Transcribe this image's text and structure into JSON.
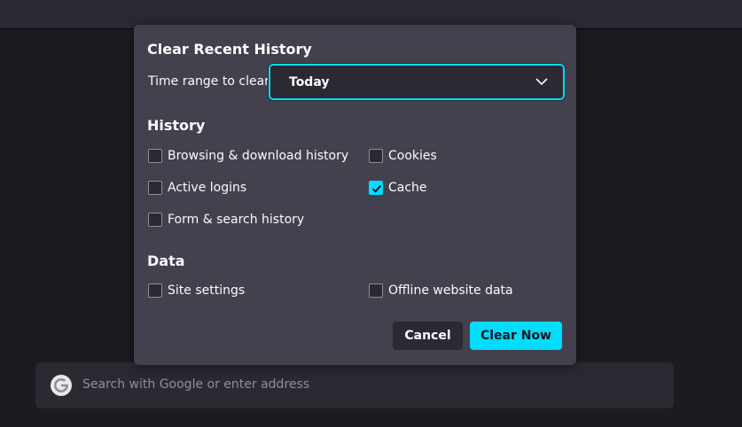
{
  "dialog": {
    "title": "Clear Recent History",
    "time_range_label": "Time range to clear:",
    "time_range_value": "Today"
  },
  "history": {
    "title": "History",
    "items": [
      {
        "label": "Browsing & download history",
        "checked": false
      },
      {
        "label": "Cookies",
        "checked": false
      },
      {
        "label": "Active logins",
        "checked": false
      },
      {
        "label": "Cache",
        "checked": true
      },
      {
        "label": "Form & search history",
        "checked": false
      }
    ]
  },
  "data": {
    "title": "Data",
    "items": [
      {
        "label": "Site settings",
        "checked": false
      },
      {
        "label": "Offline website data",
        "checked": false
      }
    ]
  },
  "buttons": {
    "cancel": "Cancel",
    "clear_now": "Clear Now"
  },
  "search": {
    "placeholder": "Search with Google or enter address"
  },
  "colors": {
    "accent": "#00ddff",
    "dialog_bg": "#42414d",
    "page_bg": "#1c1b22"
  }
}
